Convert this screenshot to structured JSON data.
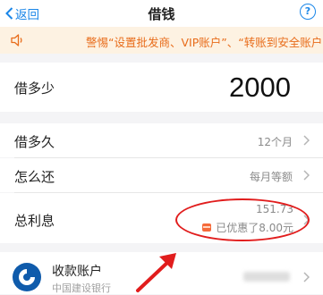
{
  "header": {
    "back_label": "返回",
    "title": "借钱",
    "help_label": "?"
  },
  "notice": {
    "text": "警惕“设置批发商、VIP账户”、“转账到安全账户”"
  },
  "loan": {
    "amount_label": "借多少",
    "amount_value": "2000",
    "term_label": "借多久",
    "term_value": "12个月",
    "repay_label": "怎么还",
    "repay_value": "每月等额",
    "interest_label": "总利息",
    "interest_value": "151.73",
    "discount_text": "已优惠了8.00元"
  },
  "account": {
    "title": "收款账户",
    "bank": "中国建设银行"
  },
  "colors": {
    "accent": "#1a86e8",
    "warning": "#e86c1a",
    "annotation": "#e11d1d",
    "bank": "#0f5bab"
  },
  "icons": [
    "chevron-left-icon",
    "help-icon",
    "speaker-icon",
    "chevron-right-icon",
    "coupon-icon",
    "ccb-bank-logo-icon",
    "red-arrow-annotation"
  ]
}
